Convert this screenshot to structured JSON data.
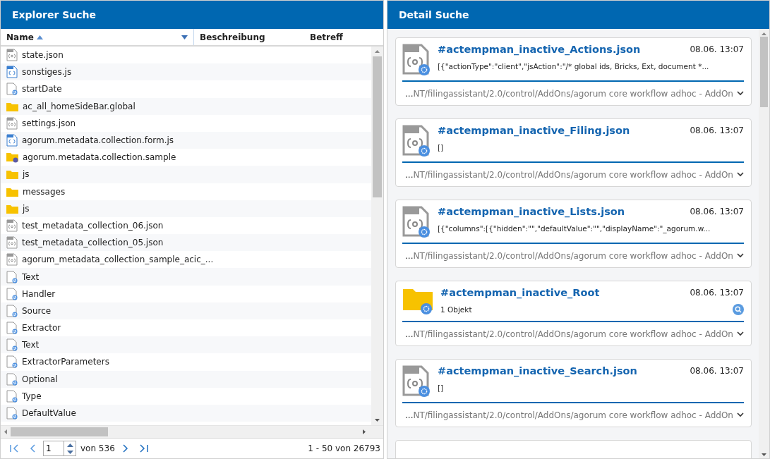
{
  "explorer": {
    "title": "Explorer Suche",
    "columns": [
      {
        "label": "Name",
        "sorted": true
      },
      {
        "label": "Beschreibung",
        "sorted": false
      },
      {
        "label": "Betreff",
        "sorted": false
      }
    ],
    "rows": [
      {
        "name": "state.json",
        "kind": "json"
      },
      {
        "name": "sonstiges.js",
        "kind": "js"
      },
      {
        "name": "startDate",
        "kind": "doc"
      },
      {
        "name": "ac_all_homeSideBar.global",
        "kind": "folder"
      },
      {
        "name": "settings.json",
        "kind": "json"
      },
      {
        "name": "agorum.metadata.collection.form.js",
        "kind": "js"
      },
      {
        "name": "agorum.metadata.collection.sample",
        "kind": "folder-linked"
      },
      {
        "name": "js",
        "kind": "folder"
      },
      {
        "name": "messages",
        "kind": "folder"
      },
      {
        "name": "js",
        "kind": "folder"
      },
      {
        "name": "test_metadata_collection_06.json",
        "kind": "json"
      },
      {
        "name": "test_metadata_collection_05.json",
        "kind": "json"
      },
      {
        "name": "agorum_metadata_collection_sample_acic_...",
        "kind": "json"
      },
      {
        "name": "Text",
        "kind": "doc"
      },
      {
        "name": "Handler",
        "kind": "doc"
      },
      {
        "name": "Source",
        "kind": "doc"
      },
      {
        "name": "Extractor",
        "kind": "doc"
      },
      {
        "name": "Text",
        "kind": "doc"
      },
      {
        "name": "ExtractorParameters",
        "kind": "doc"
      },
      {
        "name": "Optional",
        "kind": "doc"
      },
      {
        "name": "Type",
        "kind": "doc"
      },
      {
        "name": "DefaultValue",
        "kind": "doc"
      }
    ],
    "pager": {
      "page": "1",
      "of": "von 536",
      "summary": "1 - 50 von 26793"
    }
  },
  "detail": {
    "title": "Detail Suche",
    "results": [
      {
        "kind": "json",
        "title": "#actempman_inactive_Actions.json",
        "date": "08.06. 13:07",
        "preview": "[{\"actionType\":\"client\",\"jsAction\":\"/* global ids, Bricks, Ext, document *...",
        "path": "**...**NT/filingassistant/2.0/control/AddOns/agorum core workflow adhoc - AddOn",
        "search_button": false
      },
      {
        "kind": "json",
        "title": "#actempman_inactive_Filing.json",
        "date": "08.06. 13:07",
        "preview": "[]",
        "path": "**...**NT/filingassistant/2.0/control/AddOns/agorum core workflow adhoc - AddOn",
        "search_button": false
      },
      {
        "kind": "json",
        "title": "#actempman_inactive_Lists.json",
        "date": "08.06. 13:07",
        "preview": "[{\"columns\":[{\"hidden\":\"\",\"defaultValue\":\"\",\"displayName\":\"_agorum.w...",
        "path": "**...**NT/filingassistant/2.0/control/AddOns/agorum core workflow adhoc - AddOn",
        "search_button": false
      },
      {
        "kind": "folder",
        "title": "#actempman_inactive_Root",
        "date": "08.06. 13:07",
        "preview": "1 Objekt",
        "path": "**...**NT/filingassistant/2.0/control/AddOns/agorum core workflow adhoc - AddOn",
        "search_button": true
      },
      {
        "kind": "json",
        "title": "#actempman_inactive_Search.json",
        "date": "08.06. 13:07",
        "preview": "[]",
        "path": "**...**NT/filingassistant/2.0/control/AddOns/agorum core workflow adhoc - AddOn",
        "search_button": false
      }
    ]
  }
}
